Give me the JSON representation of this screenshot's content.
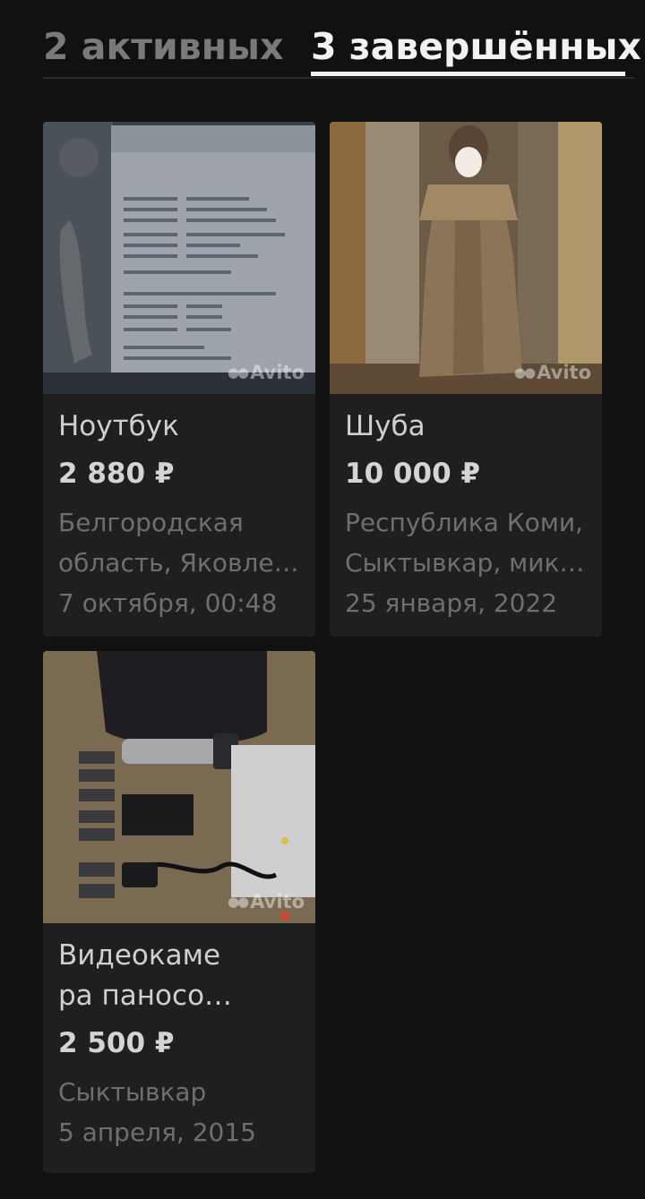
{
  "tabs": {
    "active_label": "2 активных",
    "completed_label": "3 завершённых"
  },
  "watermark": "Avito",
  "listings": [
    {
      "title_line1": "Ноутбук",
      "title_line2": "",
      "price": "2 880 ₽",
      "location_line1": "Белгородская",
      "location_line2": "область, Яковле…",
      "date": "7 октября, 00:48"
    },
    {
      "title_line1": "Шуба",
      "title_line2": "",
      "price": "10 000 ₽",
      "location_line1": "Республика Коми,",
      "location_line2": "Сыктывкар, мик…",
      "date": "25 января, 2022"
    },
    {
      "title_line1": "Видеокаме",
      "title_line2": "ра паносо…",
      "price": "2 500 ₽",
      "location_line1": "Сыктывкар",
      "location_line2": "",
      "date": "5 апреля, 2015"
    }
  ]
}
